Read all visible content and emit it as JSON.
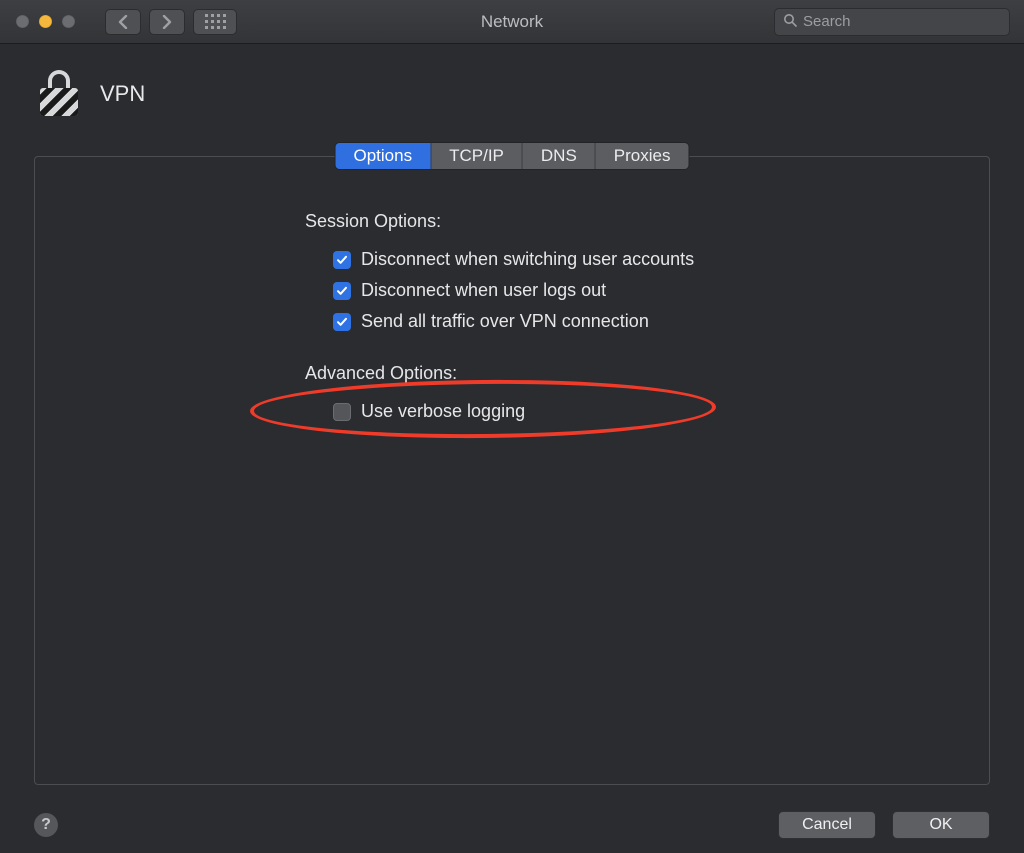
{
  "window": {
    "title": "Network"
  },
  "search": {
    "placeholder": "Search"
  },
  "header": {
    "title": "VPN"
  },
  "tabs": {
    "items": [
      "Options",
      "TCP/IP",
      "DNS",
      "Proxies"
    ],
    "active_index": 0
  },
  "session": {
    "heading": "Session Options:",
    "options": [
      {
        "label": "Disconnect when switching user accounts",
        "checked": true
      },
      {
        "label": "Disconnect when user logs out",
        "checked": true
      },
      {
        "label": "Send all traffic over VPN connection",
        "checked": true
      }
    ]
  },
  "advanced": {
    "heading": "Advanced Options:",
    "options": [
      {
        "label": "Use verbose logging",
        "checked": false
      }
    ]
  },
  "buttons": {
    "cancel": "Cancel",
    "ok": "OK",
    "help": "?"
  },
  "annotation": {
    "highlight_option_index": 2
  }
}
